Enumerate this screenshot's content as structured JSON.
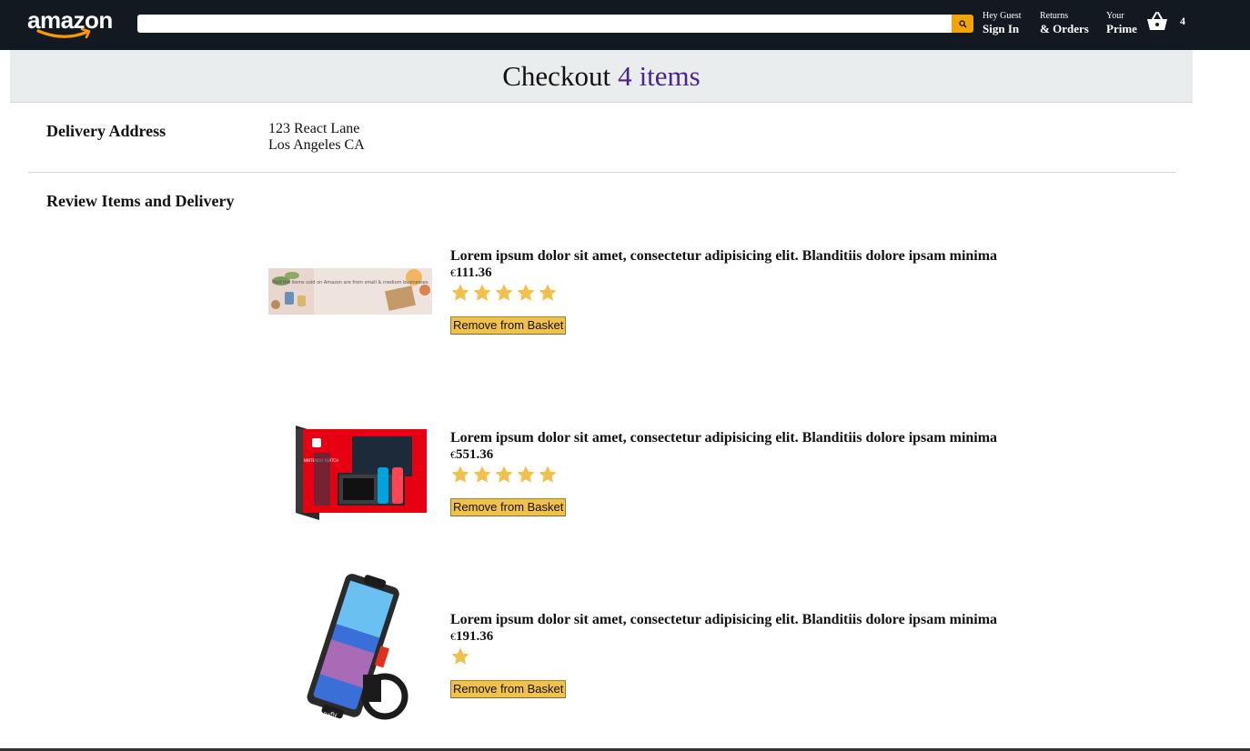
{
  "header": {
    "logo_text": "amazon",
    "search_placeholder": "",
    "nav": [
      {
        "line1": "Hey Guest",
        "line2": "Sign In"
      },
      {
        "line1": "Returns",
        "line2": "& Orders"
      },
      {
        "line1": "Your",
        "line2": "Prime"
      }
    ],
    "basket_count": "4",
    "colors": {
      "header_bg": "#131921",
      "search_button": "#f0a30a"
    }
  },
  "checkout": {
    "title": "Checkout",
    "count": "4",
    "count_label": "items"
  },
  "delivery": {
    "label": "Delivery Address",
    "line1": "123 React Lane",
    "line2": "Los Angeles CA"
  },
  "review": {
    "label": "Review Items and Delivery"
  },
  "products": [
    {
      "title": "Lorem ipsum dolor sit amet, consectetur adipisicing elit. Blanditiis dolore ipsam minima",
      "currency": "€",
      "price": "111.36",
      "rating": 5,
      "image_icon": "gift-banner-image",
      "image_text": "Half the items sold on Amazon are from small & medium businesses",
      "button": "Remove from Basket"
    },
    {
      "title": "Lorem ipsum dolor sit amet, consectetur adipisicing elit. Blanditiis dolore ipsam minima",
      "currency": "€",
      "price": "551.36",
      "rating": 5,
      "image_icon": "nintendo-switch-box-image",
      "image_text": "NINTENDO SWITCH",
      "button": "Remove from Basket"
    },
    {
      "title": "Lorem ipsum dolor sit amet, consectetur adipisicing elit. Blanditiis dolore ipsam minima",
      "currency": "€",
      "price": "191.36",
      "rating": 1,
      "image_icon": "bike-phone-mount-image",
      "image_text": "GRefly",
      "button": "Remove from Basket"
    }
  ],
  "colors": {
    "banner_bg": "#eaeded",
    "item_count": "#4a248a",
    "star": "#f0c14b",
    "button_bg": "#f0c14b"
  }
}
